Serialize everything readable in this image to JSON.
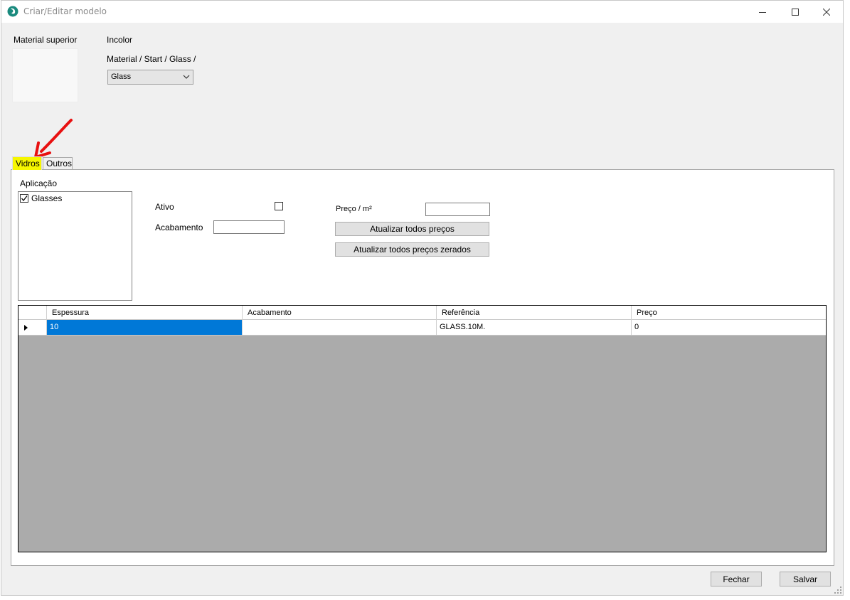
{
  "window": {
    "title": "Criar/Editar modelo",
    "buttons": [
      "minimize",
      "maximize",
      "close"
    ]
  },
  "top": {
    "material_label": "Material superior",
    "material_name": "Incolor",
    "material_path": "Material / Start / Glass /",
    "combo_value": "Glass"
  },
  "tabs": [
    {
      "label": "Vidros",
      "active": true,
      "highlight": "#f6f600"
    },
    {
      "label": "Outros",
      "active": false
    }
  ],
  "panel": {
    "aplicacao_label": "Aplicação",
    "list_items": [
      {
        "label": "Glasses",
        "checked": true
      }
    ],
    "ativo_label": "Ativo",
    "ativo_checked": false,
    "acabamento_label": "Acabamento",
    "acabamento_value": "",
    "preco_label": "Preço / m²",
    "preco_value": "",
    "btn_update_all": "Atualizar todos preços",
    "btn_update_zero": "Atualizar todos preços zerados"
  },
  "grid": {
    "columns": [
      "Espessura",
      "Acabamento",
      "Referência",
      "Preço"
    ],
    "rows": [
      {
        "espessura": "10",
        "acabamento": "",
        "referencia": "GLASS.10M.",
        "preco": "0"
      }
    ]
  },
  "footer": {
    "fechar": "Fechar",
    "salvar": "Salvar"
  },
  "colors": {
    "selection": "#0078d7",
    "tab_highlight": "#f6f600",
    "annotation_arrow": "#e81010"
  }
}
